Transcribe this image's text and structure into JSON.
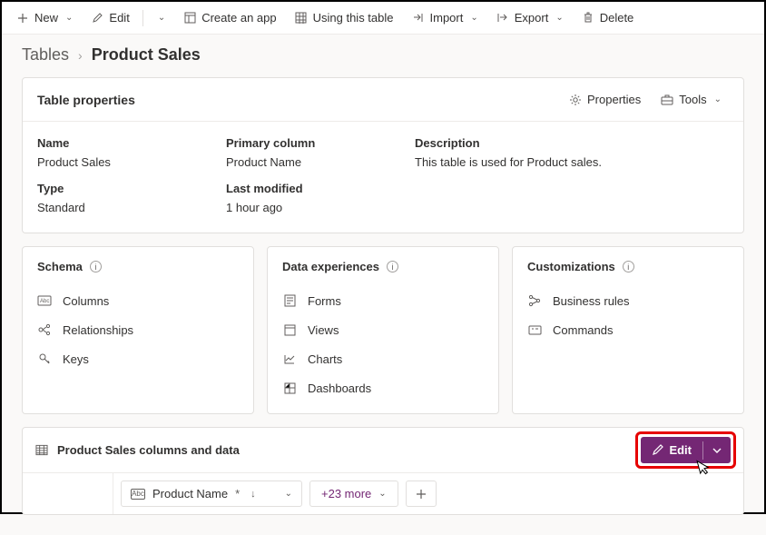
{
  "toolbar": {
    "new": "New",
    "edit": "Edit",
    "create_app": "Create an app",
    "using_table": "Using this table",
    "import": "Import",
    "export": "Export",
    "delete": "Delete"
  },
  "breadcrumb": {
    "root": "Tables",
    "leaf": "Product Sales"
  },
  "properties": {
    "title": "Table properties",
    "actions": {
      "properties": "Properties",
      "tools": "Tools"
    },
    "fields": {
      "name_label": "Name",
      "name_value": "Product Sales",
      "type_label": "Type",
      "type_value": "Standard",
      "primary_label": "Primary column",
      "primary_value": "Product Name",
      "modified_label": "Last modified",
      "modified_value": "1 hour ago",
      "desc_label": "Description",
      "desc_value": "This table is used for Product sales."
    }
  },
  "sections": {
    "schema": {
      "title": "Schema",
      "items": [
        "Columns",
        "Relationships",
        "Keys"
      ]
    },
    "data": {
      "title": "Data experiences",
      "items": [
        "Forms",
        "Views",
        "Charts",
        "Dashboards"
      ]
    },
    "custom": {
      "title": "Customizations",
      "items": [
        "Business rules",
        "Commands"
      ]
    }
  },
  "columns_card": {
    "title": "Product Sales columns and data",
    "edit": "Edit",
    "primary_chip": "Product Name",
    "more_label": "+23 more"
  }
}
